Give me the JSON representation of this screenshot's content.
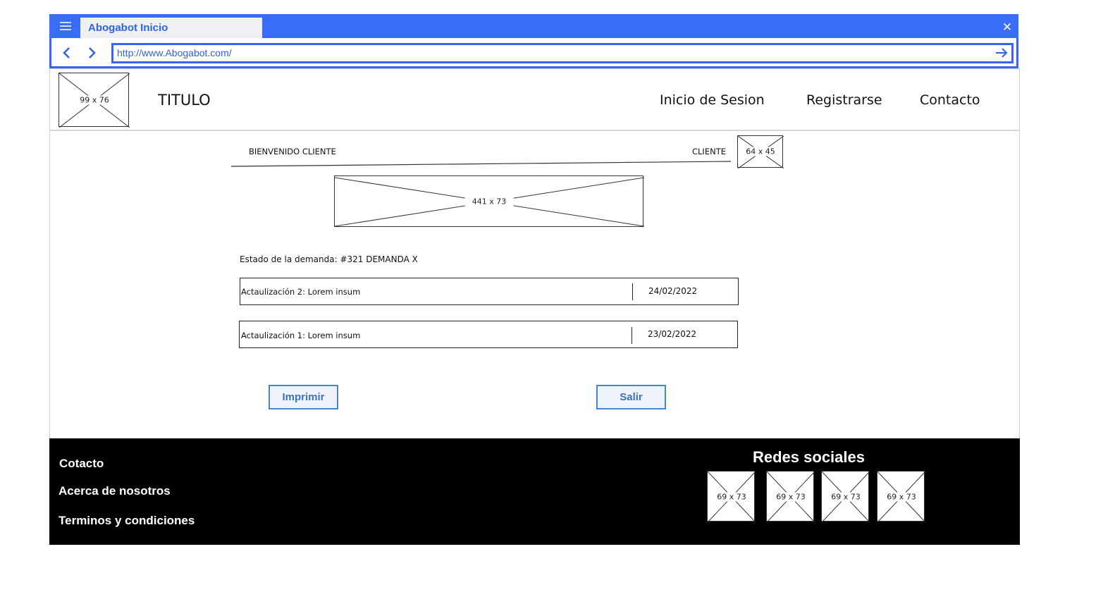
{
  "browser": {
    "tab_title": "Abogabot Inicio",
    "url": "http://www.Abogabot.com/",
    "icons": [
      "hamburger-menu-icon",
      "close-icon",
      "back-arrow-icon",
      "forward-arrow-icon",
      "go-arrow-icon"
    ]
  },
  "header": {
    "logo_placeholder": "99 x 76",
    "title": "TITULO",
    "nav": [
      "Inicio de Sesion",
      "Registrarse",
      "Contacto"
    ]
  },
  "welcome": {
    "greeting": "BIENVENIDO CLIENTE",
    "user_label": "CLIENTE",
    "avatar_placeholder": "64 x 45"
  },
  "banner_placeholder": "441 x 73",
  "case": {
    "status_label": "Estado de la demanda: #321 DEMANDA X",
    "updates": [
      {
        "label": "Actaulización 2: Lorem insum",
        "date": "24/02/2022"
      },
      {
        "label": "Actaulización 1: Lorem insum",
        "date": "23/02/2022"
      }
    ]
  },
  "actions": {
    "print_label": "Imprimir",
    "exit_label": "Salir"
  },
  "footer": {
    "links": [
      "Cotacto",
      "Acerca de nosotros",
      "Terminos y condiciones"
    ],
    "social_title": "Redes sociales",
    "social_placeholders": [
      "69 x 73",
      "69 x 73",
      "69 x 73",
      "69 x 73"
    ]
  },
  "colors": {
    "browser_accent": "#3a6df7",
    "button_border": "#4a83cf",
    "footer_bg": "#000000"
  }
}
